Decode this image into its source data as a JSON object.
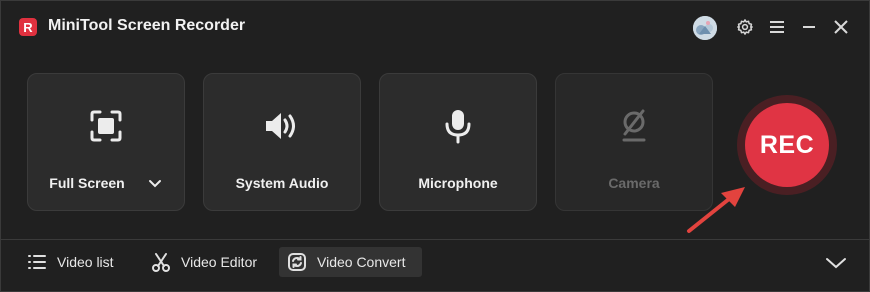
{
  "app": {
    "logo_letter": "R",
    "title": "MiniTool Screen Recorder"
  },
  "titlebar": {
    "icons": [
      "avatar",
      "gear-icon",
      "menu-icon",
      "minimize-icon",
      "close-icon"
    ]
  },
  "sources": [
    {
      "label": "Full Screen",
      "icon": "fullscreen-icon",
      "enabled": true,
      "has_dropdown": true
    },
    {
      "label": "System Audio",
      "icon": "speaker-icon",
      "enabled": true
    },
    {
      "label": "Microphone",
      "icon": "microphone-icon",
      "enabled": true
    },
    {
      "label": "Camera",
      "icon": "camera-off-icon",
      "enabled": false
    }
  ],
  "record": {
    "label": "REC",
    "color": "#e03444"
  },
  "bottom": {
    "items": [
      {
        "label": "Video list",
        "icon": "list-icon"
      },
      {
        "label": "Video Editor",
        "icon": "scissors-icon"
      },
      {
        "label": "Video Convert",
        "icon": "convert-icon",
        "active": true
      }
    ]
  },
  "colors": {
    "accent": "#e03444",
    "background": "#202020",
    "tile": "#2c2c2c"
  }
}
